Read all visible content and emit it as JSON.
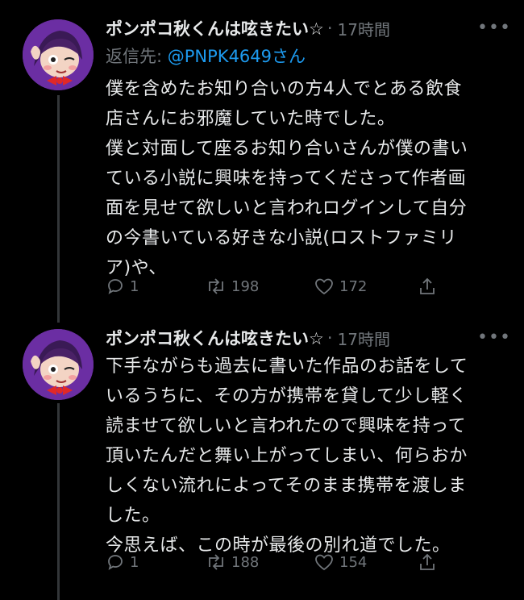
{
  "tweets": [
    {
      "name": "ポンポコ秋くんは呟きたい☆",
      "dot": "·",
      "time": "17時間",
      "more": "•••",
      "reply_label": "返信先: ",
      "reply_handle": "@PNPK4649さん",
      "lines": [
        "僕を含めたお知り合いの方4人でとある飲食",
        "店さんにお邪魔していた時でした。",
        "僕と対面して座るお知り合いさんが僕の書い",
        "ている小説に興味を持ってくださって作者画",
        "面を見せて欲しいと言われログインして自分",
        "の今書いている好きな小説(ロストファミリ",
        "ア)や、"
      ],
      "replies": "1",
      "retweets": "198",
      "likes": "172"
    },
    {
      "name": "ポンポコ秋くんは呟きたい☆",
      "dot": "·",
      "time": "17時間",
      "more": "•••",
      "lines": [
        "下手ながらも過去に書いた作品のお話をして",
        "いるうちに、その方が携帯を貸して少し軽く",
        "読ませて欲しいと言われたので興味を持って",
        "頂いたんだと舞い上がってしまい、何らおか",
        "しくない流れによってそのまま携帯を渡しま",
        "した。",
        "今思えば、この時が最後の別れ道でした。"
      ],
      "replies": "1",
      "retweets": "188",
      "likes": "154"
    }
  ],
  "colors": {
    "background": "#000000",
    "text": "#e7e9ea",
    "muted": "#71767b",
    "link": "#1d9bf0",
    "thread_line": "#333639"
  }
}
